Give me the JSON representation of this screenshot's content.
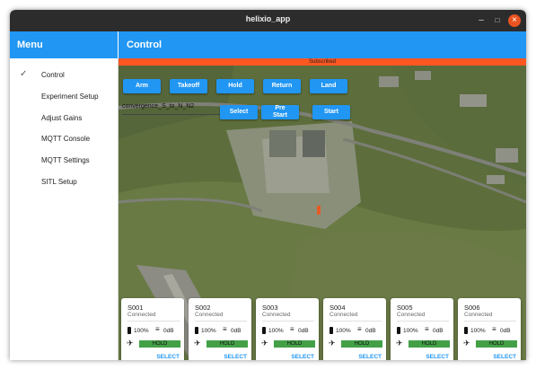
{
  "window": {
    "title": "helixio_app",
    "minimize_glyph": "–",
    "maximize_glyph": "□",
    "close_glyph": "×"
  },
  "sidebar": {
    "title": "Menu",
    "items": [
      {
        "label": "Control",
        "selected": true
      },
      {
        "label": "Experiment Setup",
        "selected": false
      },
      {
        "label": "Adjust Gains",
        "selected": false
      },
      {
        "label": "MQTT Console",
        "selected": false
      },
      {
        "label": "MQTT Settings",
        "selected": false
      },
      {
        "label": "SITL Setup",
        "selected": false
      }
    ],
    "check_glyph": "✓"
  },
  "main": {
    "title": "Control",
    "status": "Subscribed",
    "buttons_row1": [
      "Arm",
      "Takeoff",
      "Hold",
      "Return",
      "Land"
    ],
    "experiment_field": "convergence_S_to_N_N2",
    "buttons_row2": {
      "select": "Select",
      "prestart_line1": "Pre",
      "prestart_line2": "Start",
      "start": "Start"
    }
  },
  "drones": [
    {
      "id": "S001",
      "status": "Connected",
      "battery": "100%",
      "signal": "0dB",
      "mode": "HOLD",
      "action": "SELECT"
    },
    {
      "id": "S002",
      "status": "Connected",
      "battery": "100%",
      "signal": "0dB",
      "mode": "HOLD",
      "action": "SELECT"
    },
    {
      "id": "S003",
      "status": "Connected",
      "battery": "100%",
      "signal": "0dB",
      "mode": "HOLD",
      "action": "SELECT"
    },
    {
      "id": "S004",
      "status": "Connected",
      "battery": "100%",
      "signal": "0dB",
      "mode": "HOLD",
      "action": "SELECT"
    },
    {
      "id": "S005",
      "status": "Connected",
      "battery": "100%",
      "signal": "0dB",
      "mode": "HOLD",
      "action": "SELECT"
    },
    {
      "id": "S006",
      "status": "Connected",
      "battery": "100%",
      "signal": "0dB",
      "mode": "HOLD",
      "action": "SELECT"
    }
  ],
  "colors": {
    "accent": "#2196f3",
    "status_strip": "#ff5722",
    "mode_badge": "#43a047",
    "titlebar": "#2c2c2c"
  },
  "icons": {
    "wifi": "wifi-icon",
    "battery": "battery-icon",
    "plane": "airplane-icon"
  }
}
